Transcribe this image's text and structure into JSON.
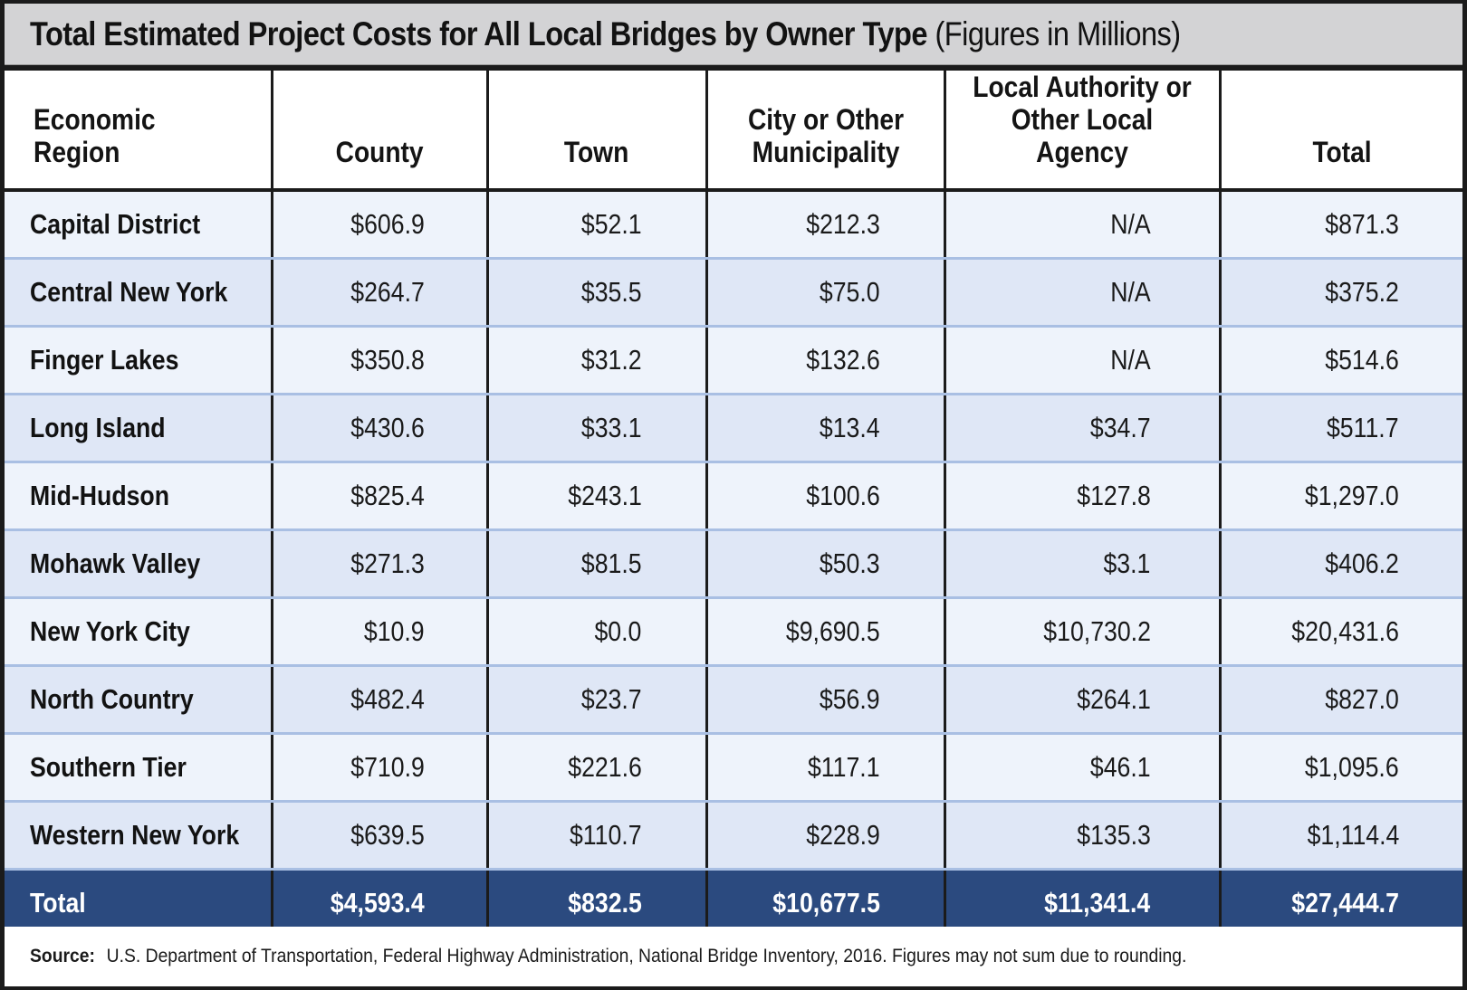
{
  "title": {
    "main": "Total Estimated Project Costs for All Local Bridges by Owner Type",
    "sub": "(Figures in Millions)"
  },
  "columns": [
    "Economic Region",
    "County",
    "Town",
    "City or Other Municipality",
    "Local Authority or Other Local Agency",
    "Total"
  ],
  "rows": [
    {
      "region": "Capital District",
      "county": "$606.9",
      "town": "$52.1",
      "city": "$212.3",
      "authority": "N/A",
      "total": "$871.3"
    },
    {
      "region": "Central New York",
      "county": "$264.7",
      "town": "$35.5",
      "city": "$75.0",
      "authority": "N/A",
      "total": "$375.2"
    },
    {
      "region": "Finger Lakes",
      "county": "$350.8",
      "town": "$31.2",
      "city": "$132.6",
      "authority": "N/A",
      "total": "$514.6"
    },
    {
      "region": "Long Island",
      "county": "$430.6",
      "town": "$33.1",
      "city": "$13.4",
      "authority": "$34.7",
      "total": "$511.7"
    },
    {
      "region": "Mid-Hudson",
      "county": "$825.4",
      "town": "$243.1",
      "city": "$100.6",
      "authority": "$127.8",
      "total": "$1,297.0"
    },
    {
      "region": "Mohawk Valley",
      "county": "$271.3",
      "town": "$81.5",
      "city": "$50.3",
      "authority": "$3.1",
      "total": "$406.2"
    },
    {
      "region": "New York City",
      "county": "$10.9",
      "town": "$0.0",
      "city": "$9,690.5",
      "authority": "$10,730.2",
      "total": "$20,431.6"
    },
    {
      "region": "North Country",
      "county": "$482.4",
      "town": "$23.7",
      "city": "$56.9",
      "authority": "$264.1",
      "total": "$827.0"
    },
    {
      "region": "Southern Tier",
      "county": "$710.9",
      "town": "$221.6",
      "city": "$117.1",
      "authority": "$46.1",
      "total": "$1,095.6"
    },
    {
      "region": "Western New York",
      "county": "$639.5",
      "town": "$110.7",
      "city": "$228.9",
      "authority": "$135.3",
      "total": "$1,114.4"
    }
  ],
  "totals": {
    "label": "Total",
    "county": "$4,593.4",
    "town": "$832.5",
    "city": "$10,677.5",
    "authority": "$11,341.4",
    "total": "$27,444.7"
  },
  "source": {
    "label": "Source:",
    "text": "U.S. Department of Transportation, Federal Highway Administration, National Bridge Inventory, 2016. Figures may not sum due to rounding."
  },
  "colors": {
    "title_bg": "#d3d3d5",
    "row_odd": "#eef3fb",
    "row_even": "#dfe7f6",
    "row_divider": "#a9bfe3",
    "total_bg": "#2b4a7f",
    "grid_line": "#1b1b1b"
  }
}
